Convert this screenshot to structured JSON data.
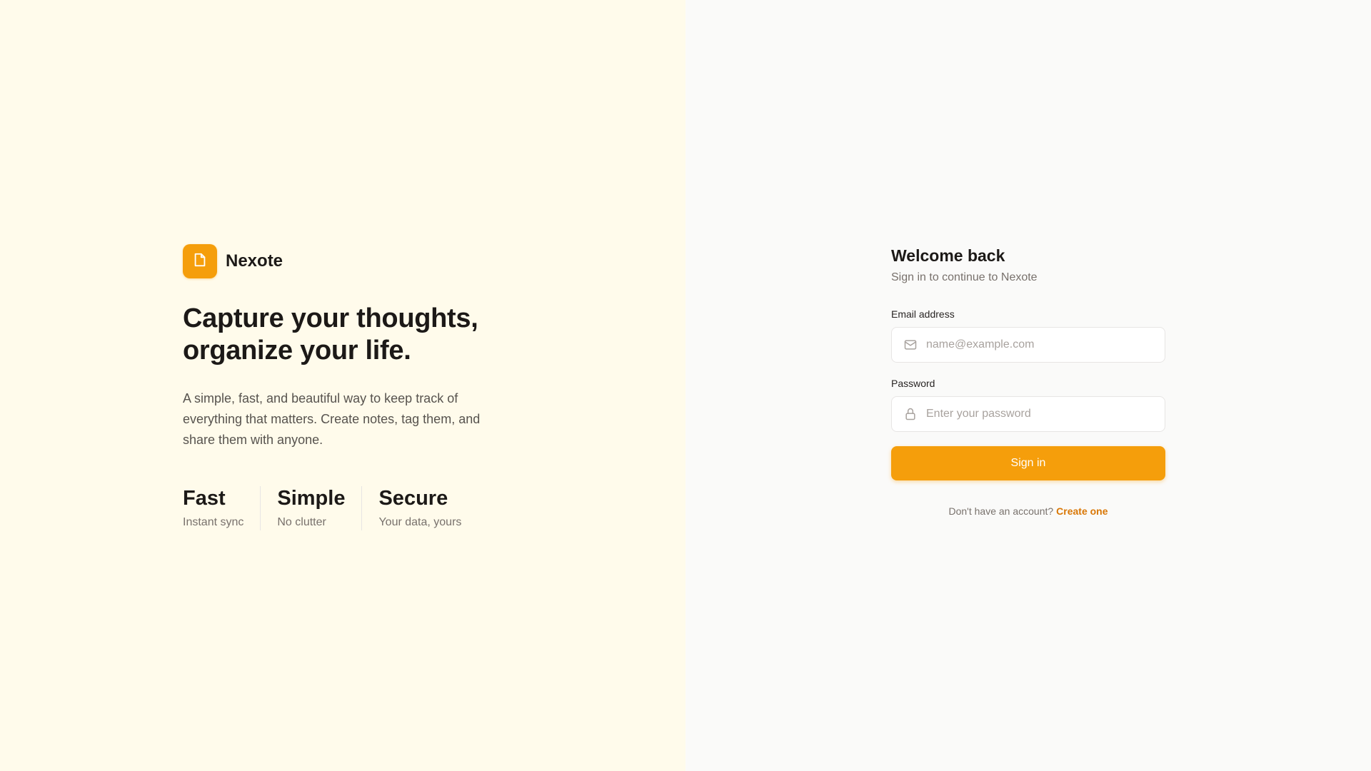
{
  "brand": {
    "name": "Nexote",
    "logo_icon": "note-icon",
    "accent_color": "#f59e0b"
  },
  "hero": {
    "headline": "Capture your thoughts, organize your life.",
    "description": "A simple, fast, and beautiful way to keep track of everything that matters. Create notes, tag them, and share them with anyone.",
    "features": [
      {
        "title": "Fast",
        "subtitle": "Instant sync"
      },
      {
        "title": "Simple",
        "subtitle": "No clutter"
      },
      {
        "title": "Secure",
        "subtitle": "Your data, yours"
      }
    ]
  },
  "login": {
    "title": "Welcome back",
    "subtitle": "Sign in to continue to Nexote",
    "email": {
      "label": "Email address",
      "placeholder": "name@example.com",
      "value": "",
      "icon": "mail-icon"
    },
    "password": {
      "label": "Password",
      "placeholder": "Enter your password",
      "value": "",
      "icon": "lock-icon"
    },
    "submit_label": "Sign in",
    "signup_prompt": "Don't have an account?",
    "signup_link": "Create one"
  },
  "colors": {
    "left_background": "#fffbeb",
    "right_background": "#fafaf9",
    "link": "#d97706"
  }
}
